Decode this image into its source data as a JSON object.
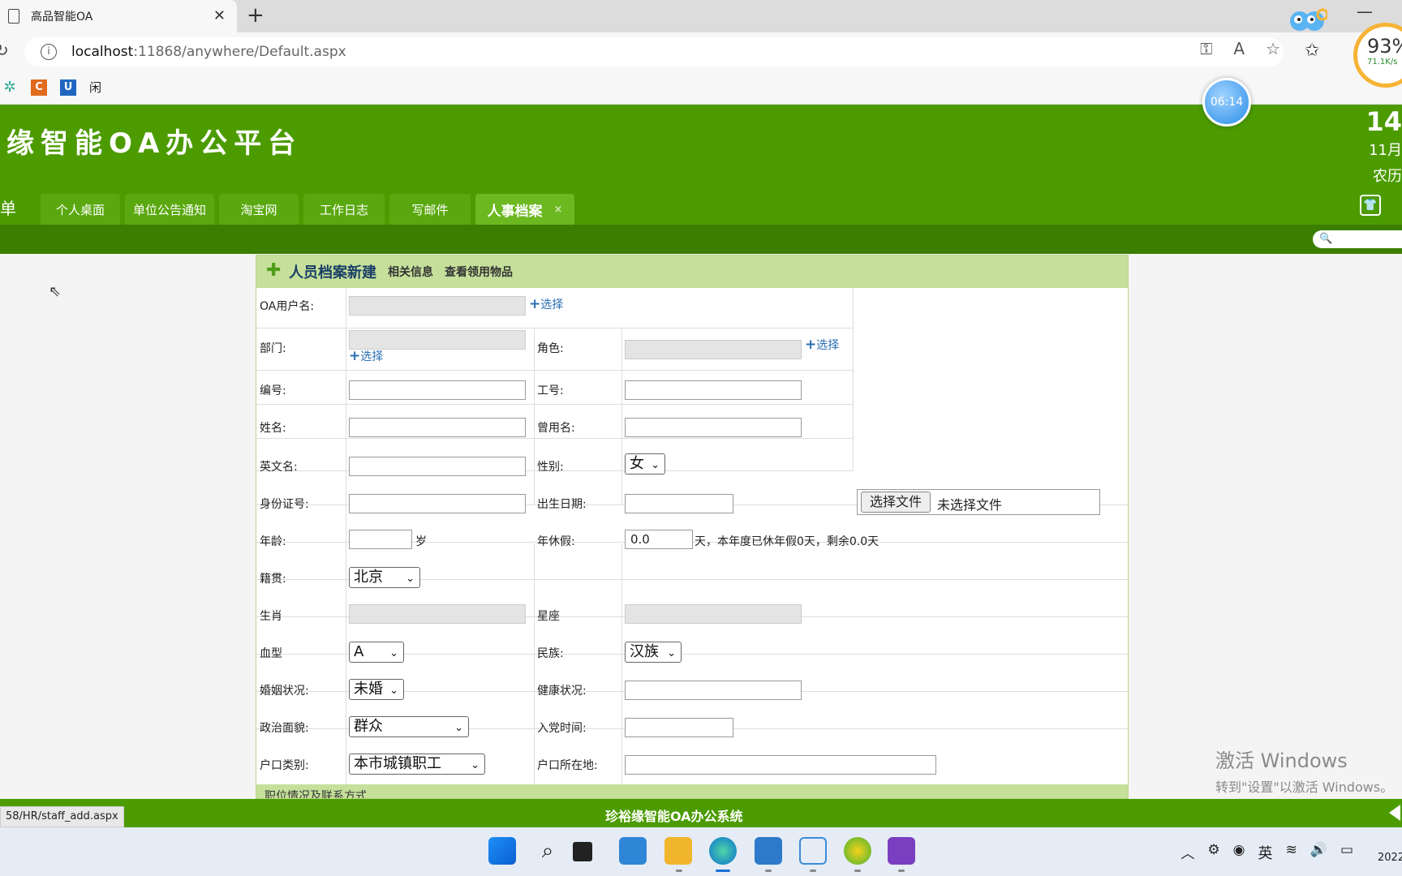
{
  "browser": {
    "tab_title": "高品智能OA",
    "url_host": "localhost",
    "url_path": ":11868/anywhere/Default.aspx",
    "bookmarks": [
      "闲"
    ]
  },
  "widgets": {
    "clock": "06:14",
    "meter_pct": "93%",
    "meter_speed": "71.1K/s"
  },
  "oa": {
    "logo": "缘智能OA办公平台",
    "nav_left": "单",
    "tabs": [
      "个人桌面",
      "单位公告通知",
      "淘宝网",
      "工作日志",
      "写邮件",
      "人事档案"
    ],
    "active_tab_close": "×",
    "date_day": "14",
    "date_month": "11月",
    "date_lunar": "农历"
  },
  "form": {
    "title": "人员档案新建",
    "links": [
      "相关信息",
      "查看领用物品"
    ],
    "pick": "选择",
    "labels": {
      "oa_user": "OA用户名:",
      "dept": "部门:",
      "role": "角色:",
      "number": "编号:",
      "job_no": "工号:",
      "name": "姓名:",
      "used_name": "曾用名:",
      "en_name": "英文名:",
      "gender": "性别:",
      "id_no": "身份证号:",
      "birth": "出生日期:",
      "age": "年龄:",
      "annual": "年休假:",
      "native": "籍贯:",
      "zodiac": "生肖",
      "constellation": "星座",
      "blood": "血型",
      "nation": "民族:",
      "marital": "婚姻状况:",
      "health": "健康状况:",
      "politics": "政治面貌:",
      "party_time": "入党时间:",
      "hukou_type": "户口类别:",
      "hukou_place": "户口所在地:"
    },
    "values": {
      "gender": "女",
      "age_unit": "岁",
      "annual_value": "0.0",
      "annual_note": "天，本年度已休年假0天，剩余0.0天",
      "native": "北京",
      "blood": "A",
      "nation": "汉族",
      "marital": "未婚",
      "politics": "群众",
      "hukou_type": "本市城镇职工"
    },
    "file_button": "选择文件",
    "file_status": "未选择文件",
    "section_next": "职位情况及联系方式"
  },
  "footer": {
    "title": "珍裕缘智能OA办公系统",
    "status_url": "58/HR/staff_add.aspx"
  },
  "watermark": {
    "line1": "激活 Windows",
    "line2": "转到\"设置\"以激活 Windows。"
  },
  "taskbar": {
    "ime": "英",
    "year": "2022"
  }
}
